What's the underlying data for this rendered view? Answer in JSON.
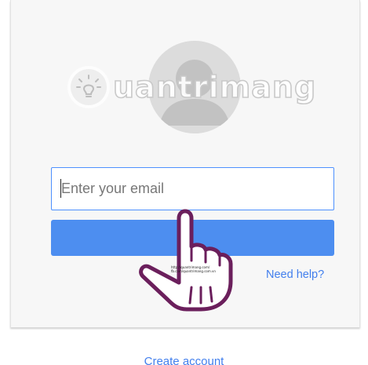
{
  "watermark": {
    "brand": "uantrimang",
    "logo_icon": "lightbulb-icon"
  },
  "avatar": {
    "icon": "default-user-avatar-icon"
  },
  "email": {
    "placeholder": "Enter your email",
    "value": ""
  },
  "next_button": {
    "label": ""
  },
  "help_link": {
    "label": "Need help?"
  },
  "create_account_link": {
    "label": "Create account"
  },
  "hand_overlay": {
    "icon": "pointing-hand-icon",
    "caption_line1": "http://quantrimang.com/",
    "caption_line2": "fb.com/quantrimang.com.vn"
  },
  "colors": {
    "primary_button": "#4d8ef0",
    "link": "#427fed",
    "input_focus_border": "#4d90fe",
    "card_background": "#f7f7f7",
    "hand_outline": "#6b1f5c"
  }
}
